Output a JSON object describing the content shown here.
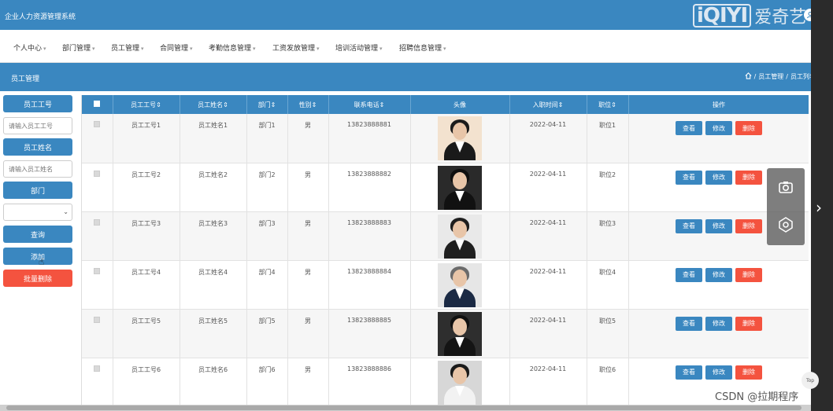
{
  "header": {
    "app_title": "企业人力资源管理系统",
    "brand_logo": "iQIYI",
    "brand_cn": "爱奇艺",
    "user_icon": "user-icon"
  },
  "menu": [
    {
      "label": "个人中心"
    },
    {
      "label": "部门管理"
    },
    {
      "label": "员工管理"
    },
    {
      "label": "合同管理"
    },
    {
      "label": "考勤信息管理"
    },
    {
      "label": "工资发放管理"
    },
    {
      "label": "培训活动管理"
    },
    {
      "label": "招聘信息管理"
    }
  ],
  "section": {
    "title": "员工管理",
    "breadcrumb": [
      "员工管理",
      "员工列表"
    ]
  },
  "filters": {
    "emp_no_label": "员工工号",
    "emp_no_placeholder": "请输入员工工号",
    "emp_name_label": "员工姓名",
    "emp_name_placeholder": "请输入员工姓名",
    "dept_label": "部门",
    "dept_value": "",
    "search_btn": "查询",
    "add_btn": "添加",
    "batch_delete_btn": "批量删除"
  },
  "table": {
    "headers": [
      "员工工号",
      "员工姓名",
      "部门",
      "性别",
      "联系电话",
      "头像",
      "入职时间",
      "职位",
      "操作"
    ],
    "actions": {
      "view": "查看",
      "edit": "修改",
      "delete": "删除"
    },
    "rows": [
      {
        "no": "员工工号1",
        "name": "员工姓名1",
        "dept": "部门1",
        "gender": "男",
        "phone": "13823888881",
        "date": "2022-04-11",
        "position": "职位1",
        "bg": "#f3e2cf",
        "hair": "#1b1b1b",
        "suit": "#1a1a1a"
      },
      {
        "no": "员工工号2",
        "name": "员工姓名2",
        "dept": "部门2",
        "gender": "男",
        "phone": "13823888882",
        "date": "2022-04-11",
        "position": "职位2",
        "bg": "#2a2a2a",
        "hair": "#0f0f0f",
        "suit": "#111111"
      },
      {
        "no": "员工工号3",
        "name": "员工姓名3",
        "dept": "部门3",
        "gender": "男",
        "phone": "13823888883",
        "date": "2022-04-11",
        "position": "职位3",
        "bg": "#e9e9e9",
        "hair": "#1e1e1e",
        "suit": "#1f1f1f"
      },
      {
        "no": "员工工号4",
        "name": "员工姓名4",
        "dept": "部门4",
        "gender": "男",
        "phone": "13823888884",
        "date": "2022-04-11",
        "position": "职位4",
        "bg": "#e6e6e6",
        "hair": "#6b6b6b",
        "suit": "#1b2a44"
      },
      {
        "no": "员工工号5",
        "name": "员工姓名5",
        "dept": "部门5",
        "gender": "男",
        "phone": "13823888885",
        "date": "2022-04-11",
        "position": "职位5",
        "bg": "#2e2e2e",
        "hair": "#101010",
        "suit": "#141414"
      },
      {
        "no": "员工工号6",
        "name": "员工姓名6",
        "dept": "部门6",
        "gender": "男",
        "phone": "13823888886",
        "date": "2022-04-11",
        "position": "职位6",
        "bg": "#d7d7d7",
        "hair": "#1a1a1a",
        "suit": "#f2f2f2"
      }
    ]
  },
  "overlay": {
    "watermark": "CSDN @拉期程序",
    "top_label": "Top",
    "camera_icon": "camera-icon",
    "target_icon": "target-icon",
    "next_icon": "chevron-right-icon"
  },
  "colors": {
    "primary": "#3a87c0",
    "danger": "#f4533f"
  }
}
